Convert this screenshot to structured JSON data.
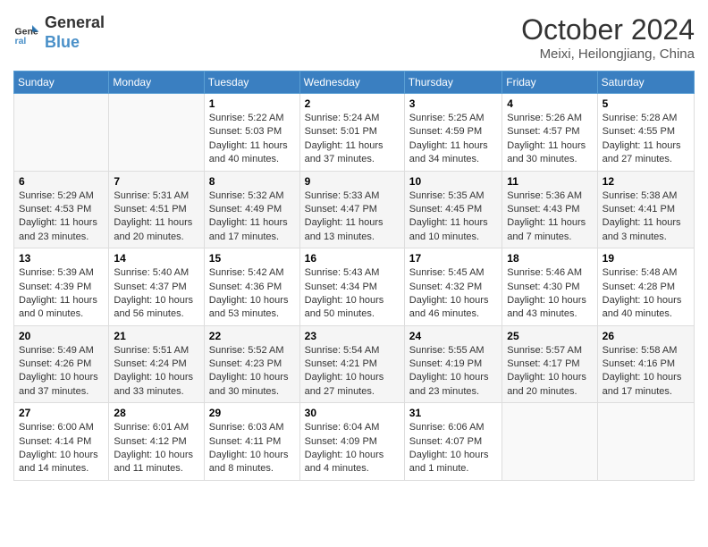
{
  "header": {
    "logo_line1": "General",
    "logo_line2": "Blue",
    "month": "October 2024",
    "location": "Meixi, Heilongjiang, China"
  },
  "weekdays": [
    "Sunday",
    "Monday",
    "Tuesday",
    "Wednesday",
    "Thursday",
    "Friday",
    "Saturday"
  ],
  "weeks": [
    [
      {
        "day": "",
        "sunrise": "",
        "sunset": "",
        "daylight": ""
      },
      {
        "day": "",
        "sunrise": "",
        "sunset": "",
        "daylight": ""
      },
      {
        "day": "1",
        "sunrise": "Sunrise: 5:22 AM",
        "sunset": "Sunset: 5:03 PM",
        "daylight": "Daylight: 11 hours and 40 minutes."
      },
      {
        "day": "2",
        "sunrise": "Sunrise: 5:24 AM",
        "sunset": "Sunset: 5:01 PM",
        "daylight": "Daylight: 11 hours and 37 minutes."
      },
      {
        "day": "3",
        "sunrise": "Sunrise: 5:25 AM",
        "sunset": "Sunset: 4:59 PM",
        "daylight": "Daylight: 11 hours and 34 minutes."
      },
      {
        "day": "4",
        "sunrise": "Sunrise: 5:26 AM",
        "sunset": "Sunset: 4:57 PM",
        "daylight": "Daylight: 11 hours and 30 minutes."
      },
      {
        "day": "5",
        "sunrise": "Sunrise: 5:28 AM",
        "sunset": "Sunset: 4:55 PM",
        "daylight": "Daylight: 11 hours and 27 minutes."
      }
    ],
    [
      {
        "day": "6",
        "sunrise": "Sunrise: 5:29 AM",
        "sunset": "Sunset: 4:53 PM",
        "daylight": "Daylight: 11 hours and 23 minutes."
      },
      {
        "day": "7",
        "sunrise": "Sunrise: 5:31 AM",
        "sunset": "Sunset: 4:51 PM",
        "daylight": "Daylight: 11 hours and 20 minutes."
      },
      {
        "day": "8",
        "sunrise": "Sunrise: 5:32 AM",
        "sunset": "Sunset: 4:49 PM",
        "daylight": "Daylight: 11 hours and 17 minutes."
      },
      {
        "day": "9",
        "sunrise": "Sunrise: 5:33 AM",
        "sunset": "Sunset: 4:47 PM",
        "daylight": "Daylight: 11 hours and 13 minutes."
      },
      {
        "day": "10",
        "sunrise": "Sunrise: 5:35 AM",
        "sunset": "Sunset: 4:45 PM",
        "daylight": "Daylight: 11 hours and 10 minutes."
      },
      {
        "day": "11",
        "sunrise": "Sunrise: 5:36 AM",
        "sunset": "Sunset: 4:43 PM",
        "daylight": "Daylight: 11 hours and 7 minutes."
      },
      {
        "day": "12",
        "sunrise": "Sunrise: 5:38 AM",
        "sunset": "Sunset: 4:41 PM",
        "daylight": "Daylight: 11 hours and 3 minutes."
      }
    ],
    [
      {
        "day": "13",
        "sunrise": "Sunrise: 5:39 AM",
        "sunset": "Sunset: 4:39 PM",
        "daylight": "Daylight: 11 hours and 0 minutes."
      },
      {
        "day": "14",
        "sunrise": "Sunrise: 5:40 AM",
        "sunset": "Sunset: 4:37 PM",
        "daylight": "Daylight: 10 hours and 56 minutes."
      },
      {
        "day": "15",
        "sunrise": "Sunrise: 5:42 AM",
        "sunset": "Sunset: 4:36 PM",
        "daylight": "Daylight: 10 hours and 53 minutes."
      },
      {
        "day": "16",
        "sunrise": "Sunrise: 5:43 AM",
        "sunset": "Sunset: 4:34 PM",
        "daylight": "Daylight: 10 hours and 50 minutes."
      },
      {
        "day": "17",
        "sunrise": "Sunrise: 5:45 AM",
        "sunset": "Sunset: 4:32 PM",
        "daylight": "Daylight: 10 hours and 46 minutes."
      },
      {
        "day": "18",
        "sunrise": "Sunrise: 5:46 AM",
        "sunset": "Sunset: 4:30 PM",
        "daylight": "Daylight: 10 hours and 43 minutes."
      },
      {
        "day": "19",
        "sunrise": "Sunrise: 5:48 AM",
        "sunset": "Sunset: 4:28 PM",
        "daylight": "Daylight: 10 hours and 40 minutes."
      }
    ],
    [
      {
        "day": "20",
        "sunrise": "Sunrise: 5:49 AM",
        "sunset": "Sunset: 4:26 PM",
        "daylight": "Daylight: 10 hours and 37 minutes."
      },
      {
        "day": "21",
        "sunrise": "Sunrise: 5:51 AM",
        "sunset": "Sunset: 4:24 PM",
        "daylight": "Daylight: 10 hours and 33 minutes."
      },
      {
        "day": "22",
        "sunrise": "Sunrise: 5:52 AM",
        "sunset": "Sunset: 4:23 PM",
        "daylight": "Daylight: 10 hours and 30 minutes."
      },
      {
        "day": "23",
        "sunrise": "Sunrise: 5:54 AM",
        "sunset": "Sunset: 4:21 PM",
        "daylight": "Daylight: 10 hours and 27 minutes."
      },
      {
        "day": "24",
        "sunrise": "Sunrise: 5:55 AM",
        "sunset": "Sunset: 4:19 PM",
        "daylight": "Daylight: 10 hours and 23 minutes."
      },
      {
        "day": "25",
        "sunrise": "Sunrise: 5:57 AM",
        "sunset": "Sunset: 4:17 PM",
        "daylight": "Daylight: 10 hours and 20 minutes."
      },
      {
        "day": "26",
        "sunrise": "Sunrise: 5:58 AM",
        "sunset": "Sunset: 4:16 PM",
        "daylight": "Daylight: 10 hours and 17 minutes."
      }
    ],
    [
      {
        "day": "27",
        "sunrise": "Sunrise: 6:00 AM",
        "sunset": "Sunset: 4:14 PM",
        "daylight": "Daylight: 10 hours and 14 minutes."
      },
      {
        "day": "28",
        "sunrise": "Sunrise: 6:01 AM",
        "sunset": "Sunset: 4:12 PM",
        "daylight": "Daylight: 10 hours and 11 minutes."
      },
      {
        "day": "29",
        "sunrise": "Sunrise: 6:03 AM",
        "sunset": "Sunset: 4:11 PM",
        "daylight": "Daylight: 10 hours and 8 minutes."
      },
      {
        "day": "30",
        "sunrise": "Sunrise: 6:04 AM",
        "sunset": "Sunset: 4:09 PM",
        "daylight": "Daylight: 10 hours and 4 minutes."
      },
      {
        "day": "31",
        "sunrise": "Sunrise: 6:06 AM",
        "sunset": "Sunset: 4:07 PM",
        "daylight": "Daylight: 10 hours and 1 minute."
      },
      {
        "day": "",
        "sunrise": "",
        "sunset": "",
        "daylight": ""
      },
      {
        "day": "",
        "sunrise": "",
        "sunset": "",
        "daylight": ""
      }
    ]
  ]
}
